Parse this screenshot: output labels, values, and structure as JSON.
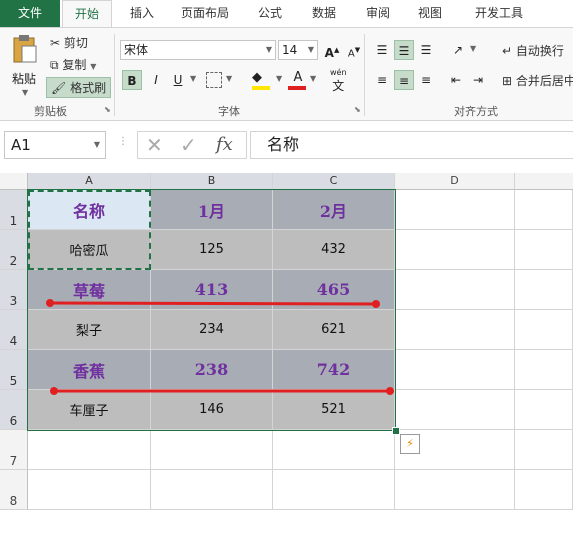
{
  "tabs": [
    "文件",
    "开始",
    "插入",
    "页面布局",
    "公式",
    "数据",
    "审阅",
    "视图",
    "开发工具"
  ],
  "clipboard": {
    "paste": "粘贴",
    "cut": "剪切",
    "copy": "复制",
    "format_painter": "格式刷",
    "group": "剪贴板"
  },
  "font": {
    "name": "宋体",
    "size": "14",
    "bold": "B",
    "italic": "I",
    "underline": "U",
    "group": "字体",
    "grow": "A",
    "shrink": "A",
    "wen": "wén"
  },
  "alignment": {
    "wrap": "自动换行",
    "merge": "合并后居中",
    "group": "对齐方式"
  },
  "formula_bar": {
    "name_box": "A1",
    "fx": "fx",
    "value": "名称"
  },
  "columns": [
    "A",
    "B",
    "C",
    "D"
  ],
  "rows": [
    "1",
    "2",
    "3",
    "4",
    "5",
    "6",
    "7",
    "8"
  ],
  "table": [
    [
      "名称",
      "1月",
      "2月"
    ],
    [
      "哈密瓜",
      "125",
      "432"
    ],
    [
      "草莓",
      "413",
      "465"
    ],
    [
      "梨子",
      "234",
      "621"
    ],
    [
      "香蕉",
      "238",
      "742"
    ],
    [
      "车厘子",
      "146",
      "521"
    ]
  ],
  "colors": {
    "accent": "#217346",
    "header_fill": "#a7acb5",
    "body_fill": "#bdbdbd",
    "header_text": "#70309f",
    "strike_line": "#e02020"
  }
}
